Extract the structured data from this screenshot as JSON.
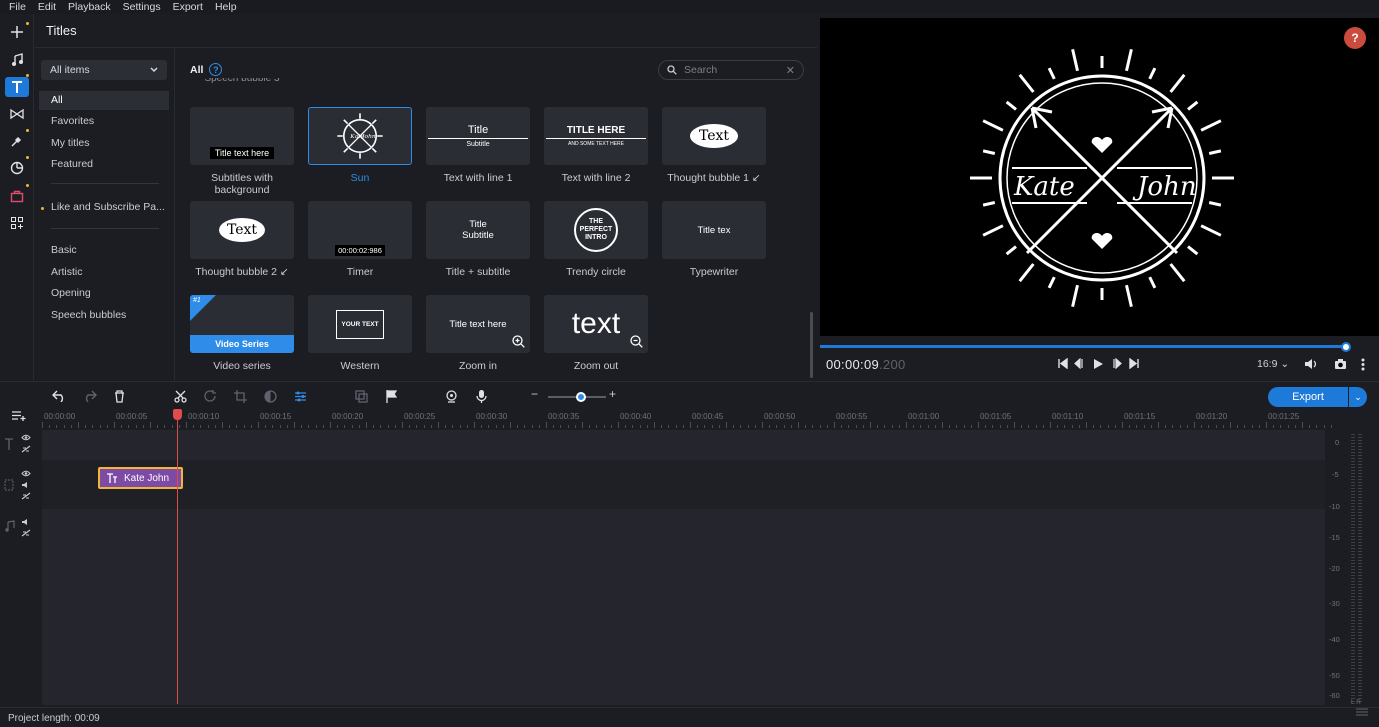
{
  "menu": [
    "File",
    "Edit",
    "Playback",
    "Settings",
    "Export",
    "Help"
  ],
  "panel_title": "Titles",
  "dropdown_label": "All items",
  "categories_top": [
    "All",
    "Favorites",
    "My titles",
    "Featured"
  ],
  "pack_item": "Like and Subscribe Pa...",
  "categories_bottom": [
    "Basic",
    "Artistic",
    "Opening",
    "Speech bubbles"
  ],
  "filter_label": "All",
  "search_placeholder": "Search",
  "tiles": [
    {
      "label": "Subtitles with background",
      "thumb_text": "Title text here"
    },
    {
      "label": "Sun",
      "thumb_text": "Kate John"
    },
    {
      "label": "Text with line 1",
      "thumb_text": "Title",
      "thumb_sub": "Subtitle"
    },
    {
      "label": "Text with line 2",
      "thumb_text": "TITLE HERE",
      "thumb_sub": "AND SOME TEXT HERE"
    },
    {
      "label": "Thought bubble 1 ↙",
      "thumb_text": "Text"
    },
    {
      "label": "Thought bubble 2 ↙",
      "thumb_text": "Text"
    },
    {
      "label": "Timer",
      "thumb_text": "00:00:02:986"
    },
    {
      "label": "Title + subtitle",
      "thumb_text": "Title",
      "thumb_sub": "Subtitle"
    },
    {
      "label": "Trendy circle",
      "thumb_text": "THE PERFECT INTRO"
    },
    {
      "label": "Typewriter",
      "thumb_text": "Title tex"
    },
    {
      "label": "Video series",
      "thumb_text": "Video Series",
      "thumb_sub": "#1"
    },
    {
      "label": "Western",
      "thumb_text": "YOUR TEXT"
    },
    {
      "label": "Zoom in",
      "thumb_text": "Title text here"
    },
    {
      "label": "Zoom out",
      "thumb_text": "text"
    }
  ],
  "preview": {
    "left_name": "Kate",
    "right_name": "John",
    "help": "?"
  },
  "timecode": {
    "main": "00:00:09",
    "ms": ".200"
  },
  "aspect": "16:9",
  "export_label": "Export",
  "ruler": [
    "00:00:00",
    "00:00:05",
    "00:00:10",
    "00:00:15",
    "00:00:20",
    "00:00:25",
    "00:00:30",
    "00:00:35",
    "00:00:40",
    "00:00:45",
    "00:00:50",
    "00:00:55",
    "00:01:00",
    "00:01:05",
    "00:01:10",
    "00:01:15",
    "00:01:20",
    "00:01:25"
  ],
  "clip_label": "Kate John",
  "meter_levels": [
    "0",
    "-5",
    "-10",
    "-15",
    "-20",
    "-30",
    "-40",
    "-50",
    "-60"
  ],
  "meter_lr": "L R",
  "status": "Project length: 00:09"
}
